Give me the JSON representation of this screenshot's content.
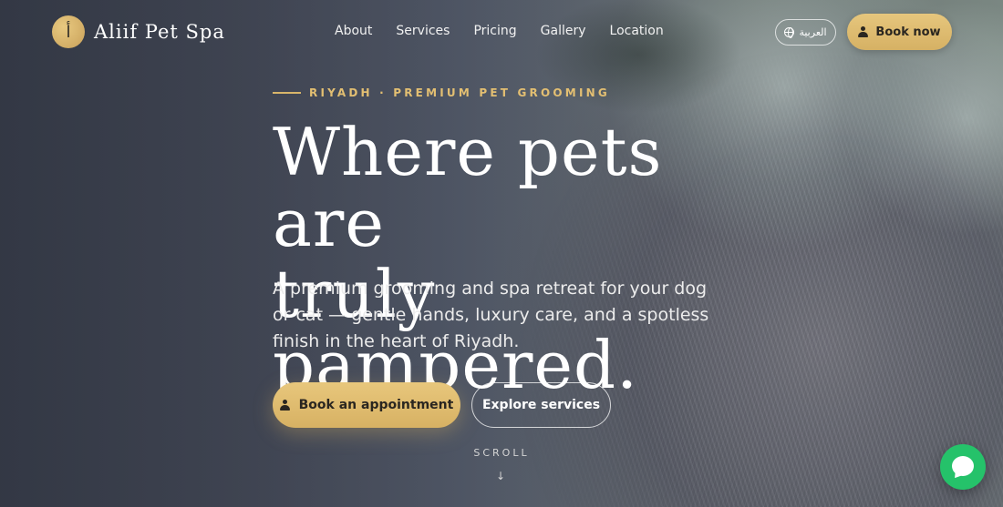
{
  "brand": {
    "logo_glyph": "أ",
    "name": "Aliif Pet Spa",
    "accent_color": "#d8b56a"
  },
  "nav": {
    "items": [
      {
        "label": "About"
      },
      {
        "label": "Services"
      },
      {
        "label": "Pricing"
      },
      {
        "label": "Gallery"
      },
      {
        "label": "Location"
      }
    ]
  },
  "header": {
    "language_label": "العربية",
    "language_icon": "globe-icon",
    "book_now_label": "Book now",
    "book_now_icon": "person-icon"
  },
  "hero": {
    "eyebrow": "RIYADH · PREMIUM PET GROOMING",
    "headline_line1": "Where pets are",
    "headline_line2": "truly pampered.",
    "subtitle": "A premium grooming and spa retreat for your dog or cat — gentle hands, luxury care, and a spotless finish in the heart of Riyadh.",
    "primary_cta": "Book an appointment",
    "secondary_cta": "Explore services",
    "scroll_label": "SCROLL",
    "scroll_arrow": "↓"
  },
  "chat": {
    "icon": "chat-bubble-icon",
    "color": "#25c26a"
  }
}
